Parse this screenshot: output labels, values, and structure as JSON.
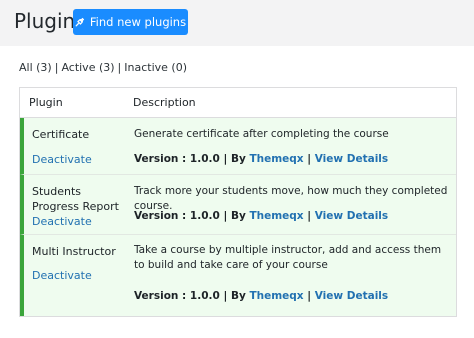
{
  "header": {
    "title": "Plugins",
    "find_button": "Find new plugins",
    "find_icon": "plug-icon"
  },
  "filters": {
    "all": "All (3)",
    "active": "Active (3)",
    "inactive": "Inactive (0)",
    "separator": "|"
  },
  "table": {
    "columns": [
      "Plugin",
      "Description"
    ],
    "rows": [
      {
        "name": "Certificate",
        "action": "Deactivate",
        "description": "Generate certificate after completing the course",
        "version_label": "Version : 1.0.0 | By",
        "author": "Themeqx",
        "divider": "|",
        "details": "View Details",
        "active": true
      },
      {
        "name": "Students Progress Report",
        "action": "Deactivate",
        "description": "Track more your students move, how much they completed course.",
        "version_label": "Version : 1.0.0 | By",
        "author": "Themeqx",
        "divider": "|",
        "details": "View Details",
        "active": true
      },
      {
        "name": "Multi Instructor",
        "action": "Deactivate",
        "description": "Take a course by multiple instructor, add and access them to build and take care of your course",
        "version_label": "Version : 1.0.0 | By",
        "author": "Themeqx",
        "divider": "|",
        "details": "View Details",
        "active": true
      }
    ]
  },
  "colors": {
    "accent": "#1a8cff",
    "link": "#2271b1",
    "active_row_bg": "#effcef",
    "active_row_border": "#3aa53a"
  }
}
